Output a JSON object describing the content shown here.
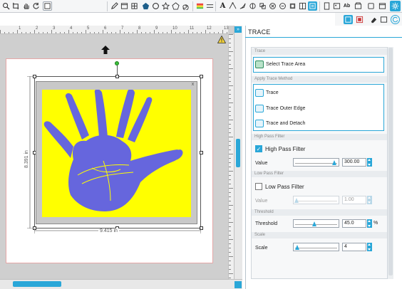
{
  "toolbar": {
    "icons": [
      "zoom-icon",
      "crop-icon",
      "pan-icon",
      "rotate-icon",
      "layers-icon",
      "text-box-icon",
      "polygon-icon",
      "circle-icon",
      "pentagon-icon",
      "star-icon",
      "heart-icon",
      "spiral-icon",
      "gradient-icon",
      "pencil-icon",
      "text-icon",
      "node-icon",
      "knife-icon",
      "modify-icon",
      "offset-icon",
      "align-icon",
      "replicate-icon",
      "fill-icon",
      "trace-icon",
      "page-setup-icon",
      "send-icon"
    ],
    "text_tool_label": "A",
    "font_tool_label": "Ab",
    "settings_icon": "gear-icon"
  },
  "canvas": {
    "ruler_numbers": [
      "1",
      "2",
      "3",
      "4",
      "5",
      "6",
      "7",
      "8",
      "9",
      "10",
      "11",
      "12",
      "13"
    ],
    "width_label": "9.415 in",
    "height_label": "8.391 in",
    "image_close_label": "x",
    "warning_icon": "warning-icon",
    "move_icon": "arrow-up-icon",
    "panel_toggle_label": "»"
  },
  "panel": {
    "title": "TRACE",
    "sections": {
      "trace": {
        "header": "Trace",
        "select_area_label": "Select Trace Area"
      },
      "method": {
        "header": "Apply Trace Method",
        "options": [
          "Trace",
          "Trace Outer Edge",
          "Trace and Detach"
        ]
      },
      "high_pass": {
        "header": "High Pass Filter",
        "checkbox_label": "High Pass Filter",
        "checked": true,
        "value_label": "Value",
        "value": "300.00",
        "slider_fraction": 0.97
      },
      "low_pass": {
        "header": "Low Pass Filter",
        "checkbox_label": "Low Pass Filter",
        "checked": false,
        "value_label": "Value",
        "value": "1.00",
        "slider_fraction": 0.0
      },
      "threshold": {
        "header": "Threshold",
        "label": "Threshold",
        "value": "45.0",
        "unit": "%",
        "slider_fraction": 0.45
      },
      "scale": {
        "header": "Scale",
        "label": "Scale",
        "value": "4",
        "slider_fraction": 0.02
      }
    }
  },
  "colors": {
    "accent": "#2aa7d8",
    "image_background": "#ffff00",
    "hand": "#6666dd",
    "canvas_background": "#cfcfcf"
  }
}
